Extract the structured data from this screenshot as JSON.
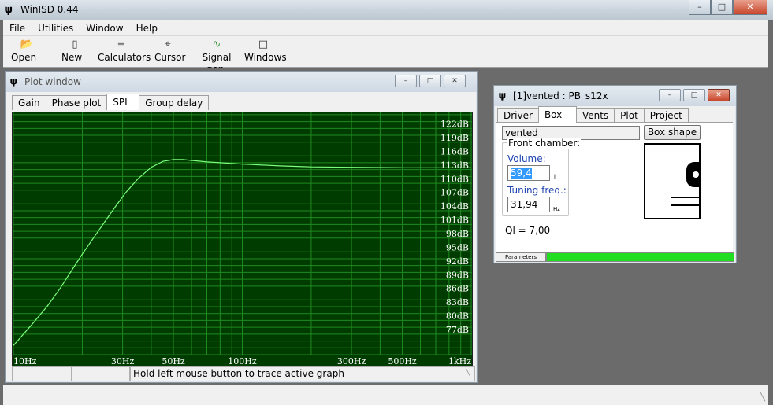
{
  "app": {
    "title": "WinISD 0.44",
    "logo_icon": "winisd-logo-icon"
  },
  "menu": [
    "File",
    "Utilities",
    "Window",
    "Help"
  ],
  "toolbar": [
    {
      "label": "Open",
      "icon": "folder-open-icon"
    },
    {
      "label": "New",
      "icon": "new-document-icon"
    },
    {
      "label": "Calculators",
      "icon": "calculator-icon"
    },
    {
      "label": "Cursor",
      "icon": "crosshair-icon"
    },
    {
      "label": "Signal gen.",
      "icon": "sine-wave-icon"
    },
    {
      "label": "Windows",
      "icon": "window-icon"
    }
  ],
  "plot_window": {
    "title": "Plot window",
    "tabs": [
      "Gain",
      "Phase plot",
      "SPL",
      "Group delay"
    ],
    "selected_tab": "SPL",
    "status_hint": "Hold left mouse button to trace active graph"
  },
  "project_window": {
    "title": "[1]vented : PB_s12x",
    "tabs": [
      "Driver",
      "Box",
      "Vents",
      "Plot",
      "Project"
    ],
    "selected_tab": "Box",
    "box_type": "vented",
    "box_shape_button": "Box shape",
    "front_chamber_label": "Front chamber:",
    "volume_label": "Volume:",
    "volume_value": "59,4",
    "volume_unit": "l",
    "tuning_label": "Tuning freq.:",
    "tuning_value": "31,94",
    "tuning_unit": "Hz",
    "ql_text": "Ql = 7,00",
    "params_label": "Parameters",
    "params_progress": 1.0
  },
  "colors": {
    "plot_bg": "#003c00",
    "grid": "#1f8a1f",
    "curve": "#7cff7c",
    "progress": "#22dd22"
  },
  "chart_data": {
    "type": "line",
    "xscale": "log",
    "x_tick_labels": [
      "10Hz",
      "30Hz",
      "50Hz",
      "100Hz",
      "300Hz",
      "500Hz",
      "1kHz"
    ],
    "x_ticks": [
      10,
      30,
      50,
      100,
      300,
      500,
      1000
    ],
    "y_tick_labels": [
      "122dB",
      "119dB",
      "116dB",
      "113dB",
      "110dB",
      "107dB",
      "104dB",
      "101dB",
      "98dB",
      "95dB",
      "92dB",
      "89dB",
      "86dB",
      "83dB",
      "80dB",
      "77dB"
    ],
    "y_ticks": [
      122,
      119,
      116,
      113,
      110,
      107,
      104,
      101,
      98,
      95,
      92,
      89,
      86,
      83,
      80,
      77
    ],
    "ylim": [
      71.5,
      124.5
    ],
    "xlim": [
      10,
      1000
    ],
    "grid": true,
    "series": [
      {
        "x": [
          10,
          12,
          14,
          16,
          18,
          20,
          22,
          25,
          28,
          31,
          35,
          40,
          45,
          50,
          55,
          60,
          70,
          80,
          100,
          150,
          200,
          300,
          500,
          700,
          1000
        ],
        "y": [
          73.5,
          78,
          82,
          86,
          90,
          93.5,
          96.5,
          100.5,
          104,
          107,
          110,
          112.5,
          113.8,
          114.2,
          114.2,
          114,
          113.7,
          113.5,
          113.2,
          112.8,
          112.6,
          112.5,
          112.4,
          112.4,
          112.4
        ]
      }
    ]
  }
}
